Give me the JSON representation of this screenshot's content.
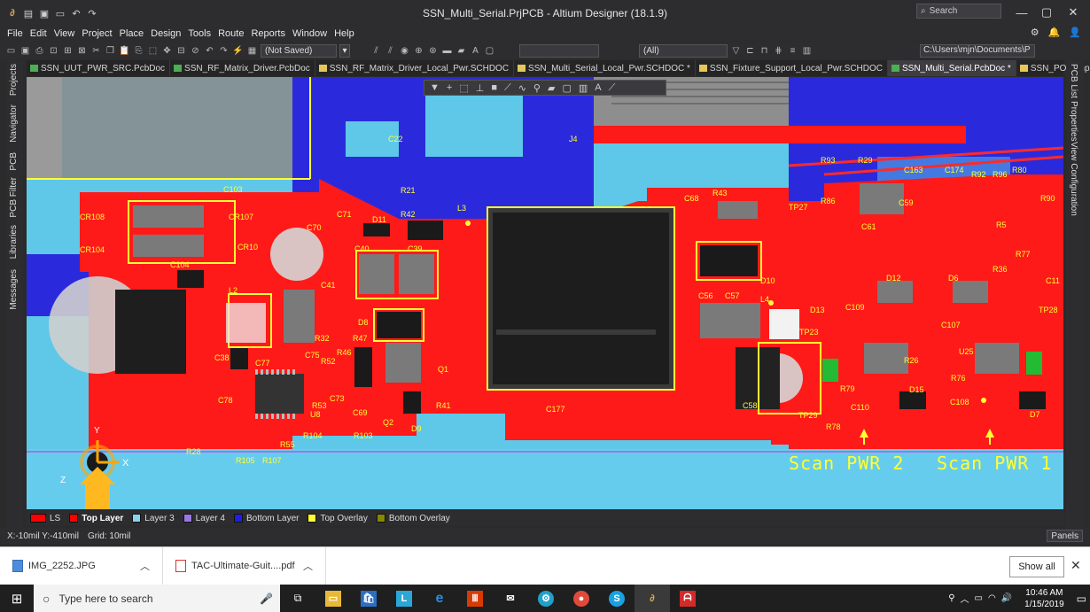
{
  "window": {
    "title": "SSN_Multi_Serial.PrjPCB - Altium Designer (18.1.9)",
    "search_placeholder": "Search"
  },
  "menu": [
    "File",
    "Edit",
    "View",
    "Project",
    "Place",
    "Design",
    "Tools",
    "Route",
    "Reports",
    "Window",
    "Help"
  ],
  "toolbar": {
    "save_state": "(Not Saved)",
    "filter_value": "(All)",
    "path": "C:\\Users\\mjn\\Documents\\P"
  },
  "tabs": [
    {
      "label": "SSN_UUT_PWR_SRC.PcbDoc",
      "type": "pcb",
      "active": false
    },
    {
      "label": "SSN_RF_Matrix_Driver.PcbDoc",
      "type": "pcb",
      "active": false
    },
    {
      "label": "SSN_RF_Matrix_Driver_Local_Pwr.SCHDOC",
      "type": "sch",
      "active": false
    },
    {
      "label": "SSN_Multi_Serial_Local_Pwr.SCHDOC *",
      "type": "sch",
      "active": false
    },
    {
      "label": "SSN_Fixture_Support_Local_Pwr.SCHDOC",
      "type": "sch",
      "active": false
    },
    {
      "label": "SSN_Multi_Serial.PcbDoc *",
      "type": "pcb",
      "active": true
    },
    {
      "label": "SSN_POE_Input.SCHDOC",
      "type": "sch",
      "active": false
    }
  ],
  "left_panels": [
    "Projects",
    "Navigator",
    "PCB",
    "PCB Filter",
    "Libraries",
    "Messages"
  ],
  "right_panels": [
    "PCB List",
    "Properties",
    "View Configuration"
  ],
  "pcb": {
    "overlay_text_1": "Scan PWR 2",
    "overlay_text_2": "Scan PWR 1",
    "designators": [
      "C103",
      "CR108",
      "CR107",
      "CR104",
      "CR10",
      "C104",
      "L2",
      "C71",
      "D11",
      "R42",
      "L3",
      "C70",
      "C40",
      "C39",
      "C41",
      "R32",
      "D8",
      "R47",
      "C38",
      "C77",
      "C75",
      "R52",
      "R46",
      "Q1",
      "C78",
      "R53",
      "C73",
      "U8",
      "C69",
      "R41",
      "R104",
      "R103",
      "Q2",
      "D9",
      "R28",
      "R55",
      "R105",
      "R107",
      "C177",
      "R21",
      "C22",
      "C68",
      "R43",
      "D10",
      "C56",
      "C57",
      "L4",
      "D13",
      "C109",
      "TP23",
      "C58",
      "TP29",
      "R79",
      "R78",
      "C110",
      "D15",
      "C108",
      "R76",
      "U25",
      "C107",
      "D12",
      "D6",
      "TP27",
      "R86",
      "C61",
      "C59",
      "R93",
      "R29",
      "C163",
      "C174",
      "R92",
      "R96",
      "R80",
      "R90",
      "R36",
      "R77",
      "R26",
      "D7",
      "TP28",
      "C11",
      "J4",
      "R5"
    ]
  },
  "layers": [
    {
      "name": "LS",
      "color": "#ff0000",
      "active": false,
      "ls": true
    },
    {
      "name": "Top Layer",
      "color": "#ff0000",
      "active": true
    },
    {
      "name": "Layer 3",
      "color": "#88d4f0",
      "active": false
    },
    {
      "name": "Layer 4",
      "color": "#9b77e6",
      "active": false
    },
    {
      "name": "Bottom Layer",
      "color": "#1e1ee6",
      "active": false
    },
    {
      "name": "Top Overlay",
      "color": "#ffff33",
      "active": false
    },
    {
      "name": "Bottom Overlay",
      "color": "#888800",
      "active": false
    }
  ],
  "status": {
    "coords": "X:-10mil Y:-410mil",
    "grid": "Grid: 10mil",
    "panels_label": "Panels"
  },
  "downloads": {
    "items": [
      "IMG_2252.JPG",
      "TAC-Ultimate-Guit....pdf"
    ],
    "show_all": "Show all"
  },
  "taskbar": {
    "search_placeholder": "Type here to search",
    "time": "10:46 AM",
    "date": "1/15/2019"
  },
  "colors": {
    "top_layer": "#ff1a1a",
    "layer3": "#5fc8e8",
    "bottom_layer": "#1e1ee6",
    "overlay": "#ffff33"
  }
}
